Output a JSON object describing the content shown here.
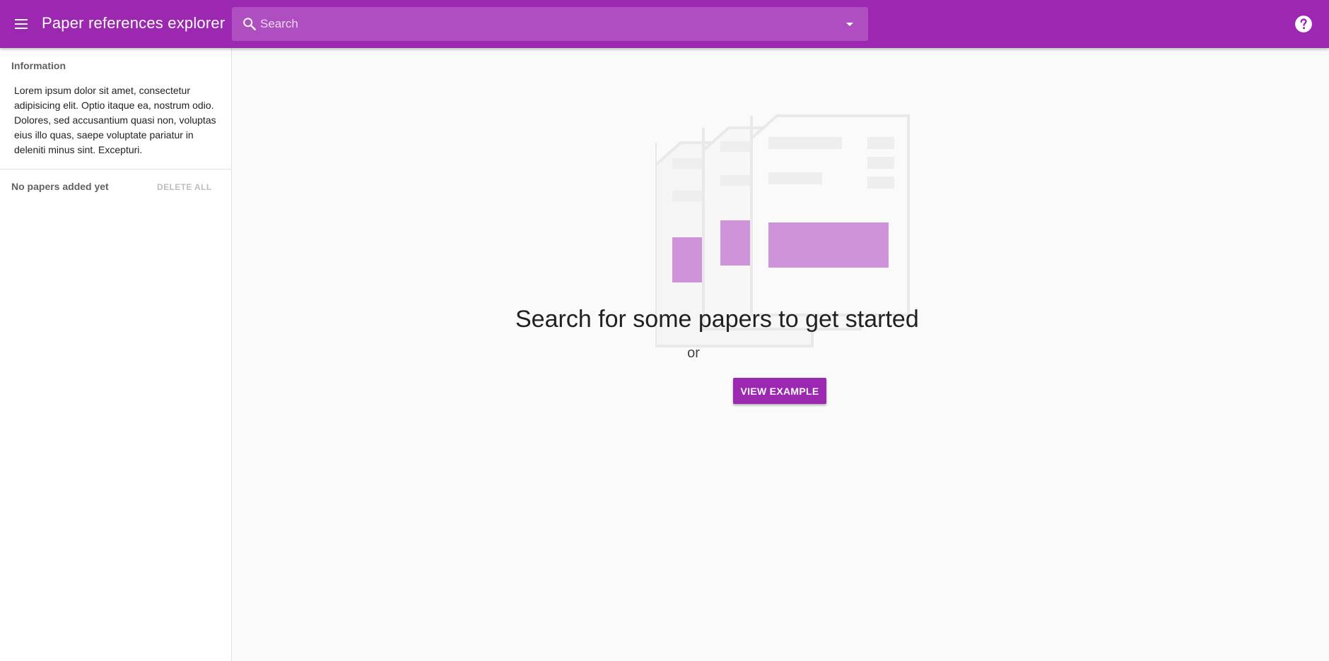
{
  "app": {
    "title": "Paper references explorer"
  },
  "search": {
    "placeholder": "Search"
  },
  "sidebar": {
    "info_heading": "Information",
    "info_text": "Lorem ipsum dolor sit amet, consectetur adipisicing elit. Optio itaque ea, nostrum odio. Dolores, sed accusantium quasi non, voluptas eius illo quas, saepe voluptate pariatur in deleniti minus sint. Excepturi.",
    "empty_label": "No papers added yet",
    "delete_all_label": "DELETE ALL"
  },
  "main": {
    "headline": "Search for some papers to get started",
    "or_text": "or",
    "view_example_label": "VIEW EXAMPLE"
  },
  "icons": {
    "menu": "menu-icon",
    "search": "search-icon",
    "dropdown": "arrow-drop-down-icon",
    "help": "help-icon"
  },
  "colors": {
    "primary": "#9c27b0",
    "search_bg": "#ae4ec0",
    "accent_block": "#ce93d8",
    "placeholder_block": "#eeeeee"
  }
}
